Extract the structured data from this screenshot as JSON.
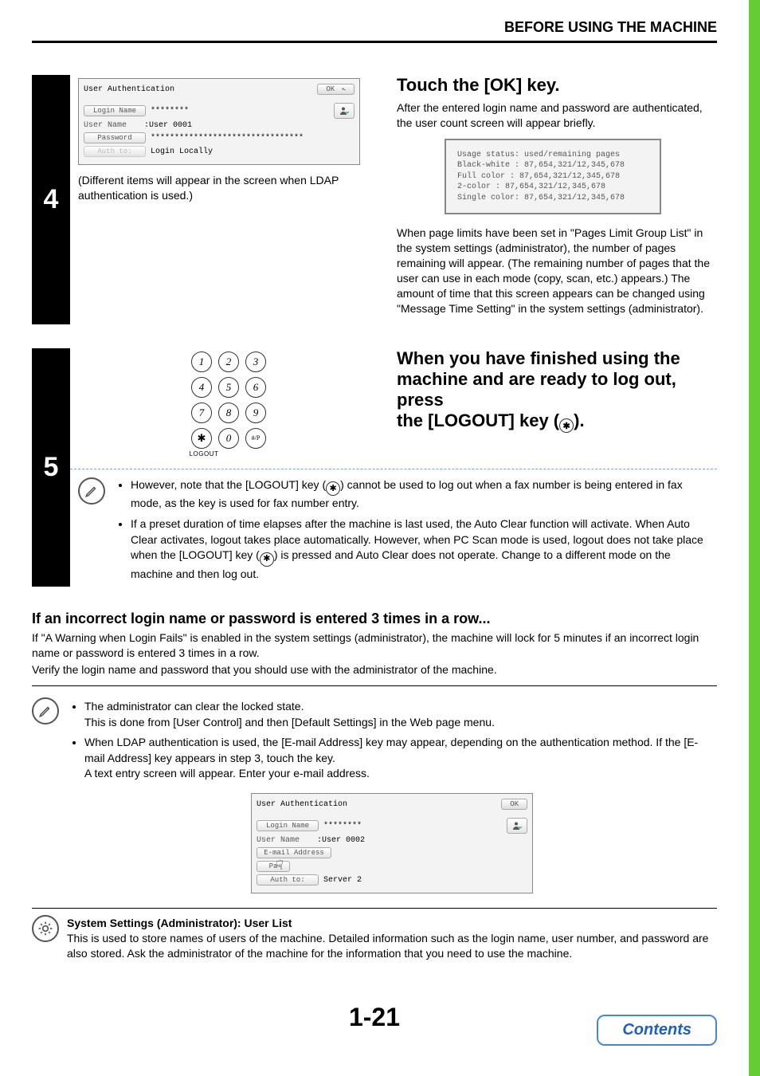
{
  "header": {
    "title": "BEFORE USING THE MACHINE"
  },
  "step4": {
    "number": "4",
    "panel": {
      "title": "User Authentication",
      "ok": "OK",
      "login_name_label": "Login Name",
      "login_name_value": "********",
      "user_name_label": "User Name",
      "user_name_value": ":User 0001",
      "password_label": "Password",
      "password_value": "********************************",
      "auth_to_label": "Auth to:",
      "auth_to_value": "Login Locally"
    },
    "caption": "(Different items will appear in the screen when LDAP authentication is used.)",
    "right_title": "Touch the [OK] key.",
    "right_body1": "After the entered login name and password are authenticated, the user count screen will appear briefly.",
    "usage": {
      "l1": "Usage status: used/remaining pages",
      "l2": "Black-white : 87,654,321/12,345,678",
      "l3": "Full color  : 87,654,321/12,345,678",
      "l4": "2-color     : 87,654,321/12,345,678",
      "l5": "Single color: 87,654,321/12,345,678"
    },
    "right_body2": "When page limits have been set in \"Pages Limit Group List\" in the system settings (administrator), the number of pages remaining will appear. (The remaining number of pages that the user can use in each mode (copy, scan, etc.) appears.) The amount of time that this screen appears can be changed using \"Message Time Setting\" in the system settings (administrator)."
  },
  "step5": {
    "number": "5",
    "title_l1": "When you have finished using the",
    "title_l2": "machine and are ready to log out, press",
    "title_l3_a": "the [LOGOUT] key (",
    "title_l3_b": ").",
    "keypad": [
      "1",
      "2",
      "3",
      "4",
      "5",
      "6",
      "7",
      "8",
      "9",
      "✱",
      "0",
      "#/P"
    ],
    "logout_label": "LOGOUT",
    "note1_a": "However, note that the [LOGOUT] key (",
    "note1_b": ") cannot be used to log out when a fax number is being entered in fax mode, as the key is used for fax number entry.",
    "note2_a": "If a preset duration of time elapses after the machine is last used, the Auto Clear function will activate. When Auto Clear activates, logout takes place automatically. However, when PC Scan mode is used, logout does not take place when the [LOGOUT] key (",
    "note2_b": ") is pressed and Auto Clear does not operate. Change to a different mode on the machine and then log out."
  },
  "section": {
    "heading": "If an incorrect login name or password is entered 3 times in a row...",
    "p1": "If \"A Warning when Login Fails\" is enabled in the system settings (administrator), the machine will lock for 5 minutes if an incorrect login name or password is entered 3 times in a row.",
    "p2": "Verify the login name and password that you should use with the administrator of the machine."
  },
  "admin_note": {
    "b1a": "The administrator can clear the locked state.",
    "b1b": "This is done from [User Control] and then [Default Settings] in the Web page menu.",
    "b2a": "When LDAP authentication is used, the [E-mail Address] key may appear, depending on the authentication method. If the [E-mail Address] key appears in step 3, touch the key.",
    "b2b": "A text entry screen will appear. Enter your e-mail address."
  },
  "panel2": {
    "title": "User Authentication",
    "ok": "OK",
    "login_name_label": "Login Name",
    "login_name_value": "********",
    "user_name_label": "User Name",
    "user_name_value": ":User 0002",
    "email_label": "E-mail Address",
    "pa_label": "Pa",
    "auth_to_label": "Auth to:",
    "auth_to_value": "Server 2"
  },
  "sys": {
    "heading": "System Settings (Administrator): User List",
    "body": "This is used to store names of users of the machine. Detailed information such as the login name, user number, and password are also stored. Ask the administrator of the machine for the information that you need to use the machine."
  },
  "footer": {
    "page_number": "1-21",
    "contents": "Contents"
  },
  "glyph": {
    "star": "✱"
  }
}
